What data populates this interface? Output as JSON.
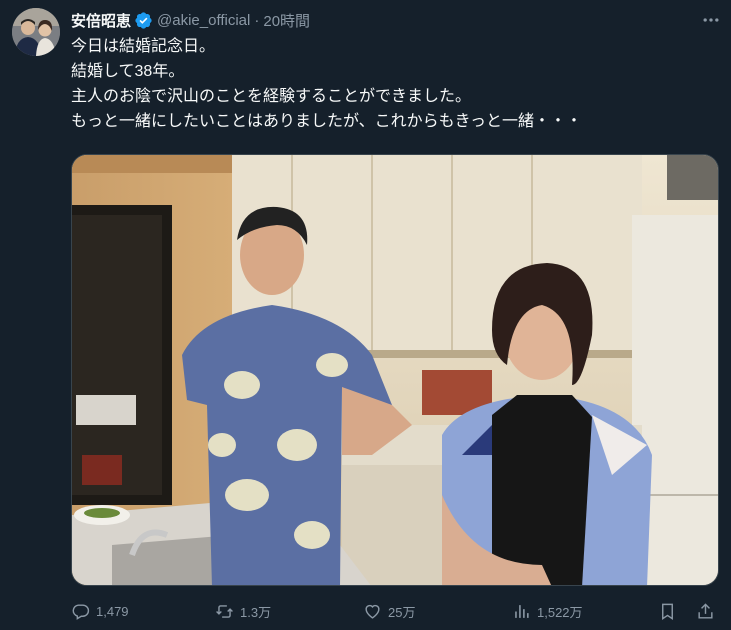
{
  "tweet": {
    "display_name": "安倍昭恵",
    "handle": "@akie_official",
    "separator": "·",
    "time": "20時間",
    "lines": [
      "今日は結婚記念日。",
      "結婚して38年。",
      "主人のお陰で沢山のことを経験することができました。",
      "もっと一緒にしたいことはありましたが、これからもきっと一緒・・・"
    ]
  },
  "actions": {
    "replies": "1,479",
    "reposts": "1.3万",
    "likes": "25万",
    "views": "1,522万"
  },
  "colors": {
    "background": "#15202b",
    "text": "#f7f9f9",
    "secondary": "#8b98a5",
    "verified": "#1d9bf0"
  },
  "icons": [
    "verified-icon",
    "more-icon",
    "reply-icon",
    "repost-icon",
    "like-icon",
    "views-icon",
    "bookmark-icon",
    "share-icon"
  ]
}
